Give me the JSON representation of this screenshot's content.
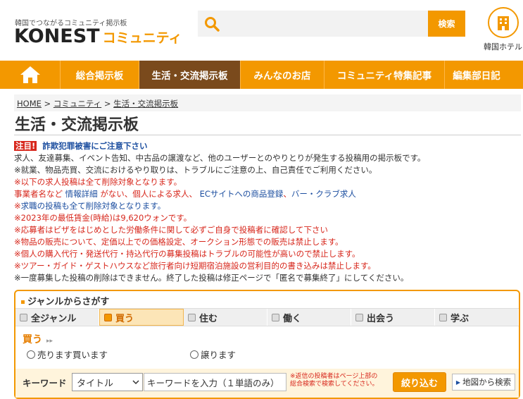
{
  "header": {
    "tagline": "韓国でつながるコミュニティ掲示板",
    "logo_main": "KONEST",
    "logo_sub": "コミュニティ",
    "search_placeholder": "",
    "search_button": "検索",
    "hotel_label": "韓国ホテル"
  },
  "nav": {
    "items": [
      "総合掲示板",
      "生活・交流掲示板",
      "みんなのお店",
      "コミュニティ特集記事",
      "編集部日記"
    ],
    "active_index": 1
  },
  "breadcrumb": {
    "items": [
      "HOME",
      "コミュニティ",
      "生活・交流掲示板"
    ],
    "separator": ">"
  },
  "page_title": "生活・交流掲示板",
  "notices": {
    "badge": "注目!",
    "warning": "詐欺犯罪被害にご注意下さい",
    "line1": "求人、友達募集、イベント告知、中古品の譲渡など、他のユーザーとのやりとりが発生する投稿用の掲示板です。",
    "line2": "※就業、物品売買、交流におけるやり取りは、トラブルにご注意の上、自己責任でご利用ください。",
    "line3": "※以下の求人投稿は全て削除対象となります。",
    "line4_a": "事業者名など",
    "line4_b": "情報詳細",
    "line4_c": "がない、個人による求人、",
    "line4_d": "ECサイトへの商品登録",
    "line4_e": "、",
    "line4_f": "バー・クラブ求人",
    "line5_a": "※",
    "line5_b": "求職の投稿も全て削除対象となります。",
    "line6": "※2023年の最低賃金(時給)は9,620ウォンです。",
    "line7": "※応募者はビザをはじめとした労働条件に関して必ずご自身で投稿者に確認して下さい",
    "line8": "※物品の販売について、定価以上での価格設定、オークション形態での販売は禁止します。",
    "line9": "※個人の購入代行・発送代行・持込代行の募集投稿はトラブルの可能性が高いので禁止します。",
    "line10": "※ツアー・ガイド・ゲストハウスなど旅行者向け短期宿泊施設の営利目的の書き込みは禁止します。",
    "line11": "※一度募集した投稿の削除はできません。終了した投稿は修正ページで「匿名で募集終了」にしてください。"
  },
  "genre": {
    "heading": "ジャンルからさがす",
    "tabs": [
      "全ジャンル",
      "買う",
      "住む",
      "働く",
      "出会う",
      "学ぶ"
    ],
    "active_tab": 1,
    "sub_title": "買う",
    "radios": [
      "売ります買います",
      "譲ります"
    ],
    "keyword_label": "キーワード",
    "select_value": "タイトル",
    "keyword_placeholder": "キーワードを入力（１単語のみ）",
    "note_line1": "※返信の投稿者はページ上部の",
    "note_line2": "総合検索で検索してください。",
    "filter_button": "絞り込む",
    "map_button": "地図から検索"
  },
  "colors": {
    "accent": "#f39800",
    "nav_active": "#7a4a1c",
    "red": "#d7261b",
    "blue": "#1d4fa0"
  }
}
